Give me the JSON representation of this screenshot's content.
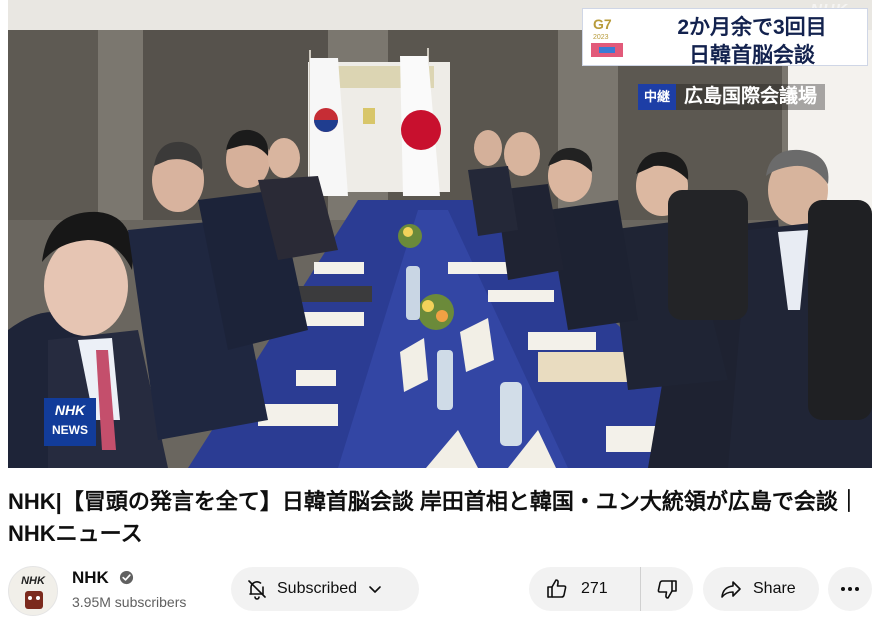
{
  "player": {
    "watermark": "NHK",
    "caption": {
      "line1": "2か月余で3回目",
      "line2": "日韓首脳会談",
      "logo_lines": [
        "G7",
        "2023",
        "HIROSHIMA",
        "SUMMIT"
      ]
    },
    "relay": {
      "badge": "中継",
      "place": "広島国際会議場"
    },
    "news_logo": {
      "top": "NHK",
      "bottom": "NEWS"
    }
  },
  "video": {
    "title": "NHK|【冒頭の発言を全て】日韓首脳会談 岸田首相と韓国・ユン大統領が広島で会談｜NHKニュース"
  },
  "channel": {
    "avatar_text": "NHK",
    "name": "NHK",
    "subscribers": "3.95M subscribers"
  },
  "actions": {
    "subscribed_label": "Subscribed",
    "like_count": "271",
    "share_label": "Share"
  },
  "icons": [
    "verified-icon",
    "bell-off-icon",
    "chevron-down-icon",
    "thumbs-up-icon",
    "thumbs-down-icon",
    "share-arrow-icon",
    "more-dots-icon"
  ],
  "colors": {
    "button_bg": "#f2f2f2",
    "caption_text": "#13224e",
    "nhk_blue": "#123c9a",
    "relay_badge": "#1d3ea6"
  }
}
